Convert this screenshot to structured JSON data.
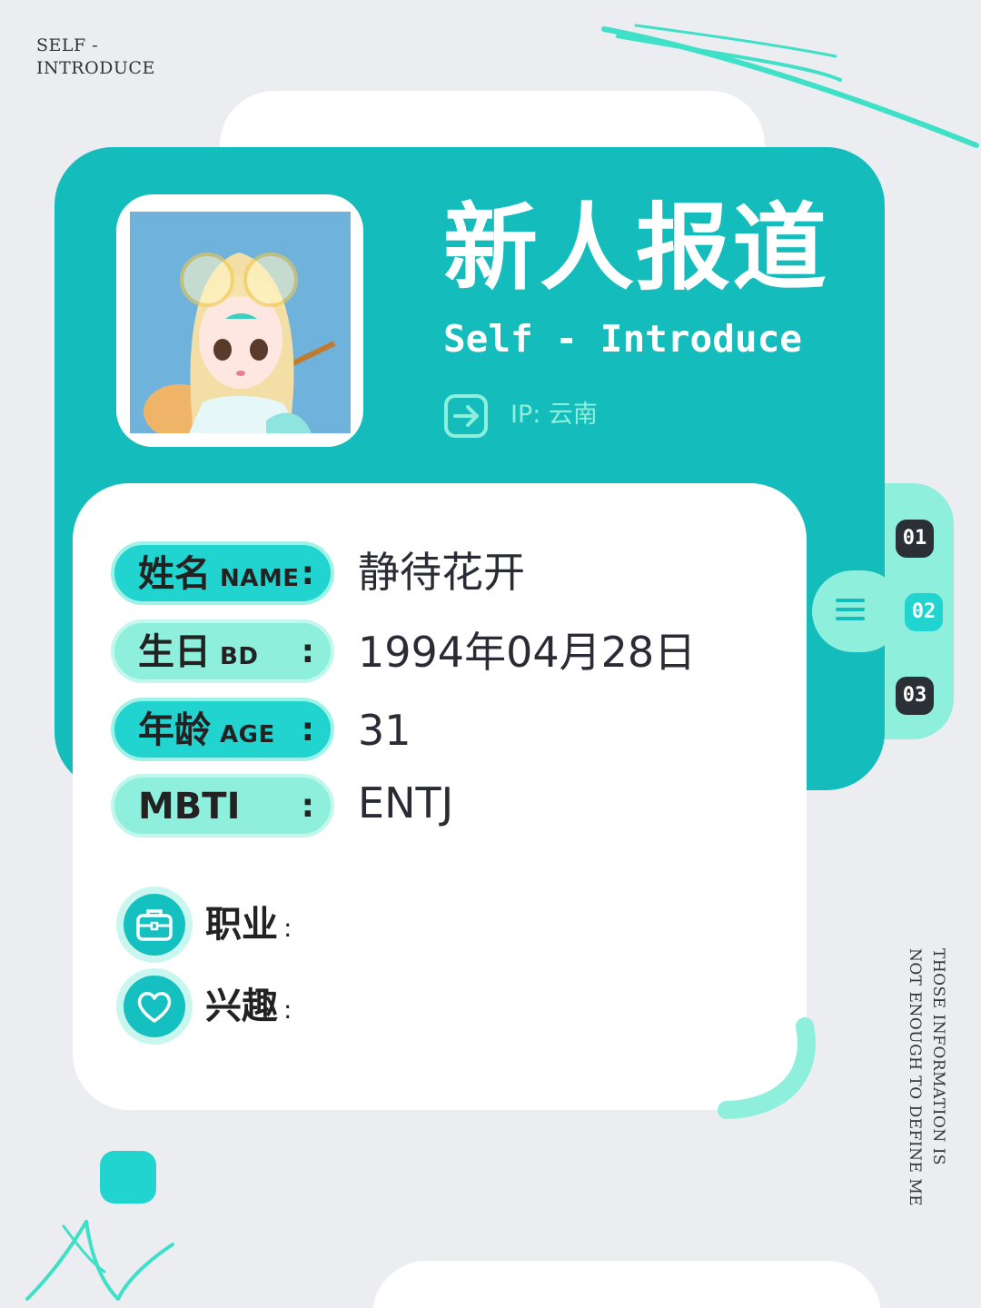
{
  "corner_label": "SELF -\nINTRODUCE",
  "side_caption": "THOSE INFORMATION IS\nNOT ENOUGH TO DEFINE ME",
  "header": {
    "title": "新人报道",
    "subtitle": "Self - Introduce",
    "ip_label": "IP: 云南"
  },
  "side_tabs": [
    "01",
    "02",
    "03"
  ],
  "fields": [
    {
      "label": "姓名",
      "tag": "NAME",
      "colon": ":",
      "value": "静待花开"
    },
    {
      "label": "生日",
      "tag": "BD",
      "colon": ":",
      "value": "1994年04月28日"
    },
    {
      "label": "年龄",
      "tag": "AGE",
      "colon": ":",
      "value": "31"
    },
    {
      "label": "MBTI",
      "tag": "",
      "colon": ":",
      "value": "ENTJ"
    }
  ],
  "extras": [
    {
      "label": "职业",
      "colon": ":",
      "icon": "briefcase-icon"
    },
    {
      "label": "兴趣",
      "colon": ":",
      "icon": "heart-icon"
    }
  ],
  "colors": {
    "teal": "#15bcbc",
    "mint": "#8ef0dc",
    "aqua": "#22d4cf",
    "background": "#ecedf0",
    "text": "#2b2b35"
  }
}
